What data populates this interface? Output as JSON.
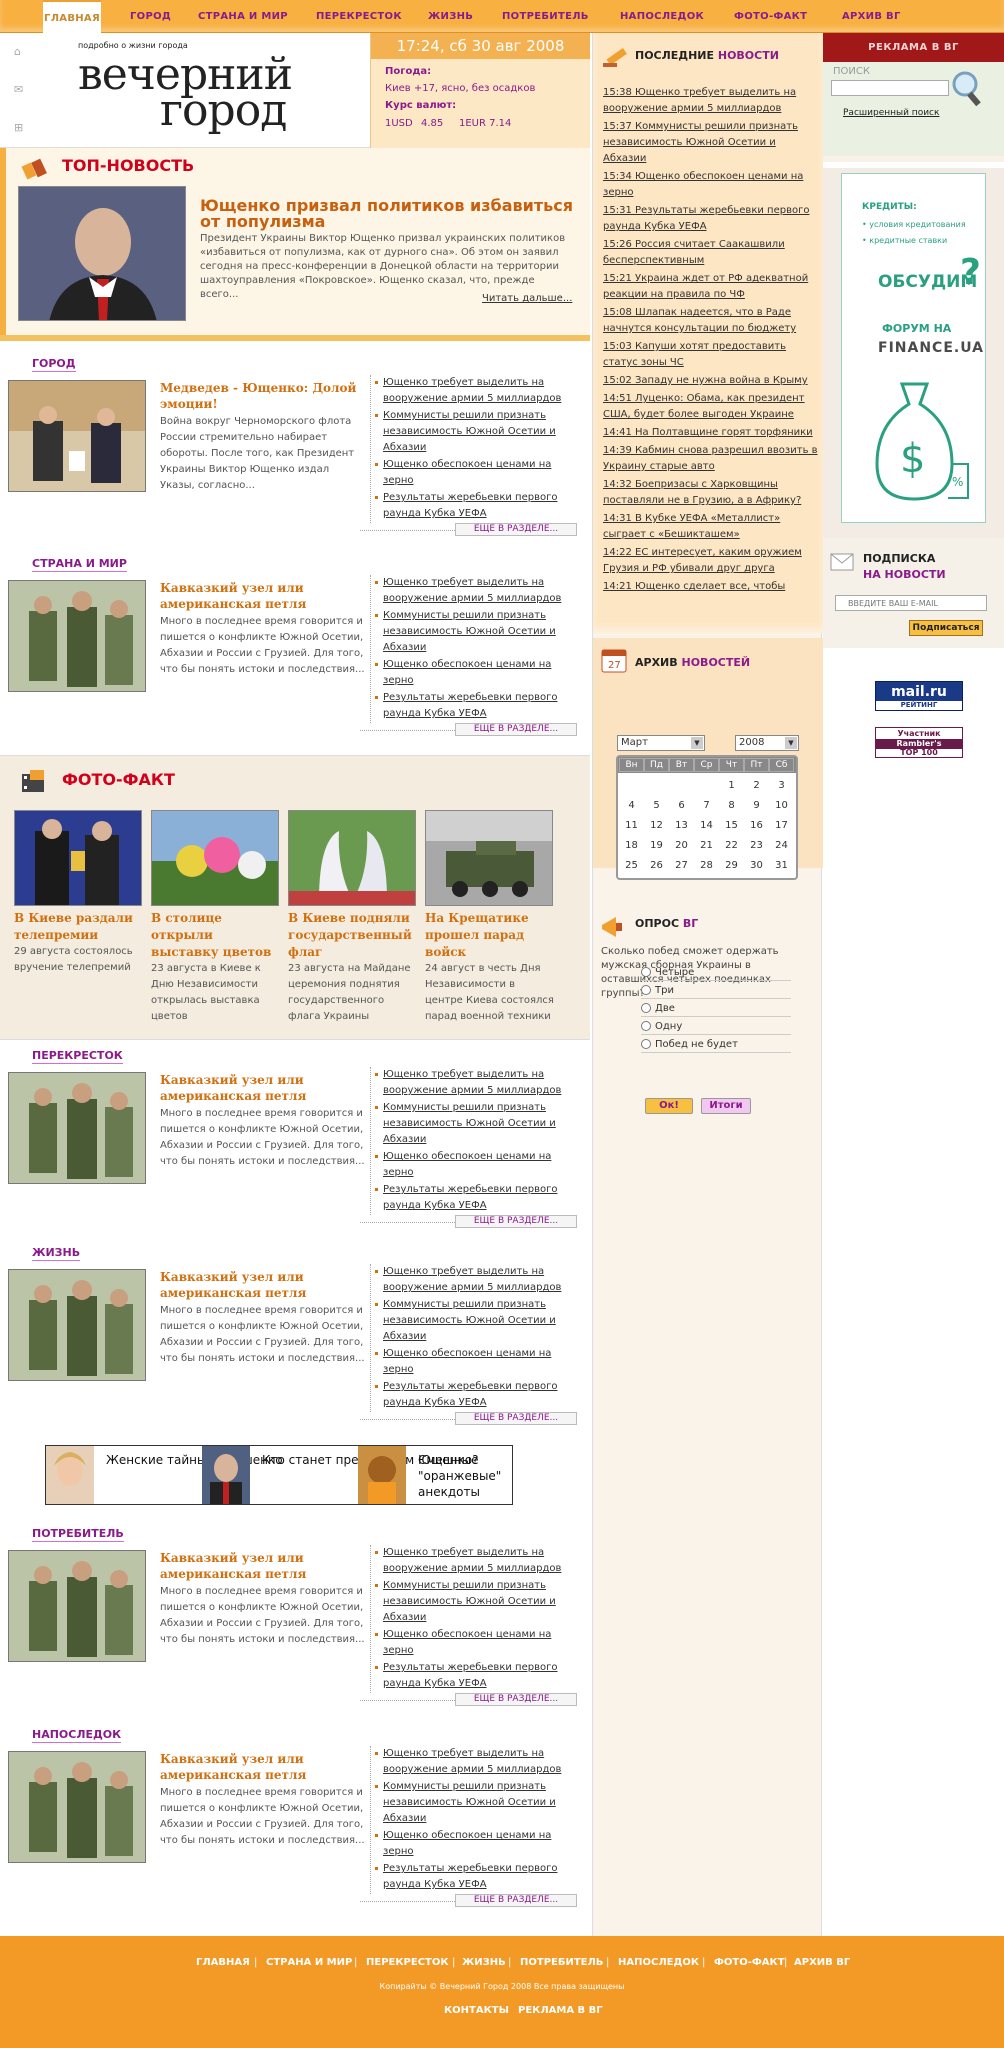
{
  "nav": {
    "items": [
      "ГЛАВНАЯ",
      "ГОРОД",
      "СТРАНА И МИР",
      "ПЕРЕКРЕСТОК",
      "ЖИЗНЬ",
      "ПОТРЕБИТЕЛЬ",
      "НАПОСЛЕДОК",
      "ФОТО-ФАКТ",
      "АРХИВ ВГ"
    ]
  },
  "header": {
    "tagline": "подробно о жизни города",
    "logo_line1": "вечерний",
    "logo_line2": "город"
  },
  "weather": {
    "datetime": "17:24, сб 30 авг 2008",
    "weather_label": "Погода:",
    "weather_value": "Киев +17, ясно, без осадков",
    "rates_label": "Курс валют:",
    "usd": "1USD",
    "usd_val": "4.85",
    "eur": "1EUR 7.14"
  },
  "topnews": {
    "title": "ТОП-НОВОСТЬ",
    "headline": "Ющенко призвал политиков избавиться от популизма",
    "text": "Президент Украины Виктор Ющенко призвал украинских политиков «избавиться от популизма, как от дурного сна». Об этом он заявил сегодня на пресс-конференции в Донецкой области на территории шахтоуправления «Покровское». Ющенко сказал, что, прежде всего...",
    "more": "Читать дальше..."
  },
  "common_list": [
    "Ющенко требует выделить на вооружение армии 5 миллиардов",
    "Коммунисты решили признать независимость Южной Осетии и Абхазии",
    "Ющенко обеспокоен ценами на зерно",
    "Результаты жеребьевки первого раунда Кубка УЕФА"
  ],
  "more_label": "ЕЩЕ В РАЗДЕЛЕ...",
  "blocks": [
    {
      "head": "ГОРОД",
      "title": "Медведев - Ющенко: Долой эмоции!",
      "text": "Война вокруг Черноморского флота России стремительно набирает обороты. После того, как Президент Украины Виктор Ющенко издал Указы, согласно..."
    },
    {
      "head": "СТРАНА И МИР",
      "title": "Кавказкий узел или американская петля",
      "text": "Много в последнее время говорится и пишется о конфликте Южной Осетии, Абхазии и России с Грузией. Для того, что бы понять истоки и последствия..."
    },
    {
      "head": "ПЕРЕКРЕСТОК",
      "title": "Кавказкий узел или американская петля",
      "text": "Много в последнее время говорится и пишется о конфликте Южной Осетии, Абхазии и России с Грузией. Для того, что бы понять истоки и последствия..."
    },
    {
      "head": "ЖИЗНЬ",
      "title": "Кавказкий узел или американская петля",
      "text": "Много в последнее время говорится и пишется о конфликте Южной Осетии, Абхазии и России с Грузией. Для того, что бы понять истоки и последствия..."
    },
    {
      "head": "ПОТРЕБИТЕЛЬ",
      "title": "Кавказкий узел или американская петля",
      "text": "Много в последнее время говорится и пишется о конфликте Южной Осетии, Абхазии и России с Грузией. Для того, что бы понять истоки и последствия..."
    },
    {
      "head": "НАПОСЛЕДОК",
      "title": "Кавказкий узел или американская петля",
      "text": "Много в последнее время говорится и пишется о конфликте Южной Осетии, Абхазии и России с Грузией. Для того, что бы понять истоки и последствия..."
    }
  ],
  "photofact": {
    "title": "ФОТО-ФАКТ",
    "items": [
      {
        "title": "В Киеве раздали телепремии",
        "text": "29 августа состоялось вручение телепремий"
      },
      {
        "title": "В столице открыли выставку цветов",
        "text": "23 августа в Киеве к Дню Независимости открылась выставка цветов"
      },
      {
        "title": "В Киеве подняли государственный флаг",
        "text": "23 августа на Майдане церемония поднятия государственного флага Украины"
      },
      {
        "title": "На Крещатике прошел парад войск",
        "text": "24 август в честь Дня Независимости в центре Киева состоялся парад военной техники"
      }
    ]
  },
  "banner": {
    "items": [
      "Женские тайны Тимошенко",
      "Кто станет преемником Ющенко?",
      "Смешные \"оранжевые\" анекдоты"
    ]
  },
  "latest": {
    "title_a": "ПОСЛЕДНИЕ",
    "title_b": "НОВОСТИ",
    "items": [
      "15:38 Ющенко требует выделить на вооружение армии 5 миллиардов",
      "15:37 Коммунисты решили признать независимость Южной Осетии и Абхазии",
      "15:34 Ющенко обеспокоен ценами на зерно",
      "15:31 Результаты жеребьевки первого раунда Кубка УЕФА",
      "15:26 Россия считает Саакашвили бесперспективным",
      "15:21 Украина ждет от РФ адекватной реакции на правила по ЧФ",
      "15:08 Шлапак надеется, что в Раде начнутся консультации по бюджету",
      "15:03 Капуши хотят предоставить статус зоны ЧС",
      "15:02 Западу не нужна война в Крыму",
      "14:51 Луценко: Обама, как президент США, будет более выгоден Украине",
      "14:41 На Полтавщине горят торфяники",
      "14:39 Кабмин снова разрешил ввозить в Украину старые авто",
      "14:32 Боепризасы с Харковщины поставляли не в Грузию, а в Африку?",
      "14:31 В Кубке УЕФА «Металлист» сыграет с «Бешикташем»",
      "14:22 ЕС интересует, каким оружием Грузия и РФ убивали друг друга",
      "14:21 Ющенко сделает все, чтобы"
    ]
  },
  "archive": {
    "title_a": "АРХИВ",
    "title_b": "НОВОСТЕЙ",
    "icon_day": "27",
    "month": "Март",
    "year": "2008",
    "days_head": [
      "Вн",
      "Пд",
      "Вт",
      "Ср",
      "Чт",
      "Пт",
      "Сб"
    ],
    "cells": [
      "",
      "",
      "",
      "",
      "1",
      "2",
      "3",
      "4",
      "5",
      "6",
      "7",
      "8",
      "9",
      "10",
      "11",
      "12",
      "13",
      "14",
      "15",
      "16",
      "17",
      "18",
      "19",
      "20",
      "21",
      "22",
      "23",
      "24",
      "25",
      "26",
      "27",
      "28",
      "29",
      "30",
      "31"
    ]
  },
  "poll": {
    "title_a": "ОПРОС",
    "title_b": "ВГ",
    "question": "Сколько побед сможет одержать мужская сборная Украины в оставшихся четырех поединках группы?",
    "options": [
      "Четыре",
      "Три",
      "Две",
      "Одну",
      "Побед не будет"
    ],
    "ok": "Ок!",
    "results": "Итоги"
  },
  "right": {
    "ad_title": "РЕКЛАМА В ВГ",
    "search_label": "ПОИСК",
    "adv_search": "Расширенный поиск",
    "ad_line1": "КРЕДИТЫ:",
    "ad_line2": "• условия кредитования",
    "ad_line3": "• кредитные ставки",
    "ad_big": "ОБСУДИМ",
    "ad_q": "?",
    "ad_forum": "ФОРУМ НА",
    "ad_site": "FINANCE.UA",
    "sub_title_a": "ПОДПИСКА",
    "sub_title_b": "НА НОВОСТИ",
    "email_placeholder": "ВВЕДИТЕ ВАШ E-MAIL",
    "sub_button": "Подписаться",
    "mail_badge": "mail.ru",
    "mail_sub": "РЕЙТИНГ",
    "rambler1": "Участник",
    "rambler2": "Rambler's",
    "rambler3": "TOP 100"
  },
  "footer": {
    "links": [
      "ГЛАВНАЯ",
      "СТРАНА И МИР",
      "ПЕРЕКРЕСТОК",
      "ЖИЗНЬ",
      "ПОТРЕБИТЕЛЬ",
      "НАПОСЛЕДОК",
      "ФОТО-ФАКТ",
      "АРХИВ ВГ"
    ],
    "copyright": "Копирайты © Вечерний Город 2008 Все права защищены",
    "contacts": "КОНТАКТЫ",
    "ads": "РЕКЛАМА В ВГ"
  },
  "colors": {
    "orange": "#f39a26",
    "purple": "#8b1a8b",
    "red": "#d2001a",
    "title_orange": "#d07010"
  }
}
